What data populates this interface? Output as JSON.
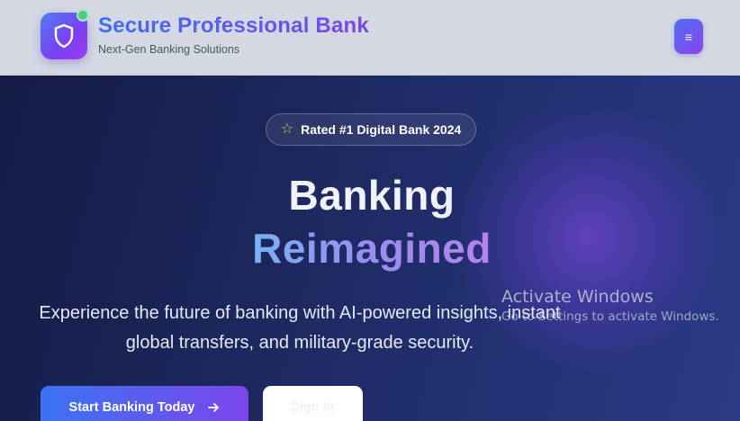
{
  "header": {
    "brand_title": "Secure Professional Bank",
    "brand_subtitle": "Next-Gen Banking Solutions",
    "logo_icon": "shield-icon",
    "menu_icon": "hamburger-icon",
    "menu_symbol": "≡"
  },
  "hero": {
    "badge_icon": "star-icon",
    "badge_symbol": "☆",
    "badge_text": "Rated #1 Digital Bank 2024",
    "headline_line1": "Banking",
    "headline_line2": "Reimagined",
    "description": "Experience the future of banking with AI-powered insights, instant global transfers, and military-grade security.",
    "primary_button": "Start Banking Today",
    "primary_button_icon": "arrow-right-icon",
    "secondary_button": "Sign in"
  },
  "watermark": {
    "title": "Activate Windows",
    "subtitle": "Go to Settings to activate Windows."
  },
  "colors": {
    "accent_blue": "#3f6ff0",
    "accent_purple": "#7a47e8",
    "status_green": "#4ec98a",
    "star_yellow": "#f4c542"
  }
}
